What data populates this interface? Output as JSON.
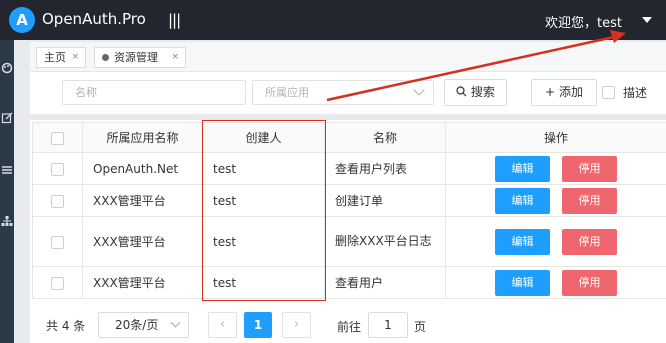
{
  "header": {
    "logo_letter": "A",
    "brand": "OpenAuth.Pro",
    "menu_toggle": "|||",
    "welcome": "欢迎您，test"
  },
  "tabs": [
    {
      "label": "主页",
      "close": "×"
    },
    {
      "label": "资源管理",
      "close": "×"
    }
  ],
  "toolbar": {
    "name_placeholder": "名称",
    "app_placeholder": "所属应用",
    "search_label": "搜索",
    "add_label": "添加",
    "desc_label": "描述"
  },
  "table": {
    "headers": [
      "",
      "所属应用名称",
      "创建人",
      "名称",
      "操作"
    ],
    "rows": [
      {
        "app": "OpenAuth.Net",
        "creator": "test",
        "name": "查看用户列表"
      },
      {
        "app": "XXX管理平台",
        "creator": "test",
        "name": "创建订单"
      },
      {
        "app": "XXX管理平台",
        "creator": "test",
        "name": "删除XXX平台日志"
      },
      {
        "app": "XXX管理平台",
        "creator": "test",
        "name": "查看用户"
      }
    ],
    "edit_label": "编辑",
    "disable_label": "停用"
  },
  "pager": {
    "total": "共 4 条",
    "page_size": "20条/页",
    "prev": "‹",
    "current": "1",
    "next": "›",
    "goto_prefix": "前往",
    "goto_value": "1",
    "goto_suffix": "页"
  },
  "colors": {
    "header_bg": "#23262e",
    "primary": "#1e9fff",
    "danger": "#f0666e",
    "highlight": "#d3301d"
  }
}
